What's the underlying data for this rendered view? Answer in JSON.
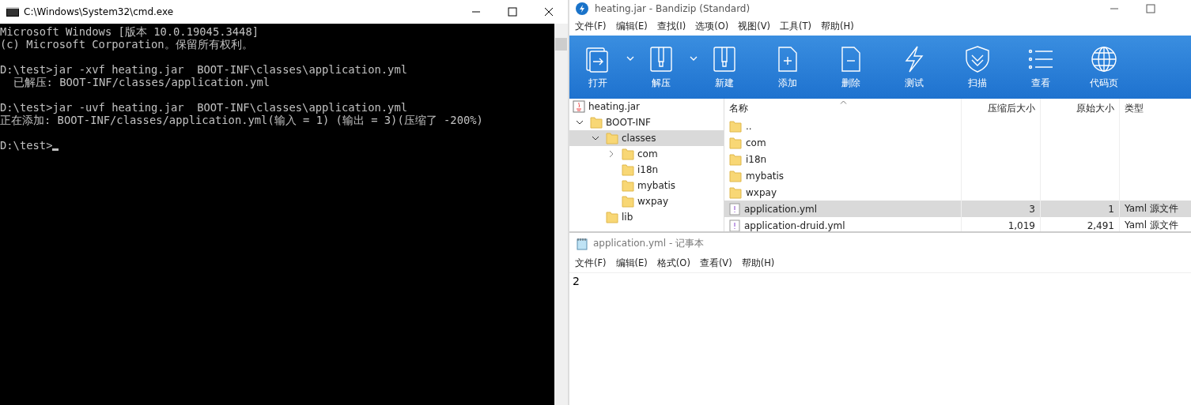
{
  "cmd": {
    "title": "C:\\Windows\\System32\\cmd.exe",
    "blocks": [
      [
        "Microsoft Windows [版本 10.0.19045.3448]",
        "(c) Microsoft Corporation。保留所有权利。"
      ],
      [
        "D:\\test>jar -xvf heating.jar  BOOT-INF\\classes\\application.yml",
        "  已解压: BOOT-INF/classes/application.yml"
      ],
      [
        "D:\\test>jar -uvf heating.jar  BOOT-INF\\classes\\application.yml",
        "正在添加: BOOT-INF/classes/application.yml(输入 = 1) (输出 = 3)(压缩了 -200%)"
      ],
      [
        "D:\\test>"
      ]
    ],
    "cursor": true
  },
  "bandizip": {
    "title": "heating.jar - Bandizip (Standard)",
    "menu": [
      "文件(F)",
      "编辑(E)",
      "查找(I)",
      "选项(O)",
      "视图(V)",
      "工具(T)",
      "帮助(H)"
    ],
    "toolbar": [
      {
        "label": "打开",
        "has_menu": true
      },
      {
        "label": "解压",
        "has_menu": true
      },
      {
        "label": "新建",
        "has_menu": false
      },
      {
        "label": "添加",
        "has_menu": false
      },
      {
        "label": "删除",
        "has_menu": false
      },
      {
        "label": "测试",
        "has_menu": false
      },
      {
        "label": "扫描",
        "has_menu": false
      },
      {
        "label": "查看",
        "has_menu": false
      },
      {
        "label": "代码页",
        "has_menu": false
      }
    ],
    "tree": [
      {
        "label": "heating.jar",
        "kind": "archive",
        "selected": false,
        "children": [
          {
            "label": "BOOT-INF",
            "kind": "folder",
            "selected": false,
            "expanded": true,
            "children": [
              {
                "label": "classes",
                "kind": "folder",
                "selected": true,
                "expanded": true,
                "children": [
                  {
                    "label": "com",
                    "kind": "folder",
                    "selected": false,
                    "expanded": false
                  },
                  {
                    "label": "i18n",
                    "kind": "folder",
                    "selected": false
                  },
                  {
                    "label": "mybatis",
                    "kind": "folder",
                    "selected": false
                  },
                  {
                    "label": "wxpay",
                    "kind": "folder",
                    "selected": false
                  }
                ]
              },
              {
                "label": "lib",
                "kind": "folder",
                "selected": false
              }
            ]
          }
        ]
      }
    ],
    "columns": [
      "名称",
      "压缩后大小",
      "原始大小",
      "类型"
    ],
    "rows": [
      {
        "kind": "folder",
        "name": "..",
        "selected": false
      },
      {
        "kind": "folder",
        "name": "com",
        "selected": false
      },
      {
        "kind": "folder",
        "name": "i18n",
        "selected": false
      },
      {
        "kind": "folder",
        "name": "mybatis",
        "selected": false
      },
      {
        "kind": "folder",
        "name": "wxpay",
        "selected": false
      },
      {
        "kind": "file",
        "name": "application.yml",
        "packed": "3",
        "size": "1",
        "type": "Yaml 源文件",
        "selected": true
      },
      {
        "kind": "file",
        "name": "application-druid.yml",
        "packed": "1,019",
        "size": "2,491",
        "type": "Yaml 源文件",
        "selected": false
      }
    ]
  },
  "notepad": {
    "title": "application.yml - 记事本",
    "menu": [
      "文件(F)",
      "编辑(E)",
      "格式(O)",
      "查看(V)",
      "帮助(H)"
    ],
    "text": "2"
  }
}
